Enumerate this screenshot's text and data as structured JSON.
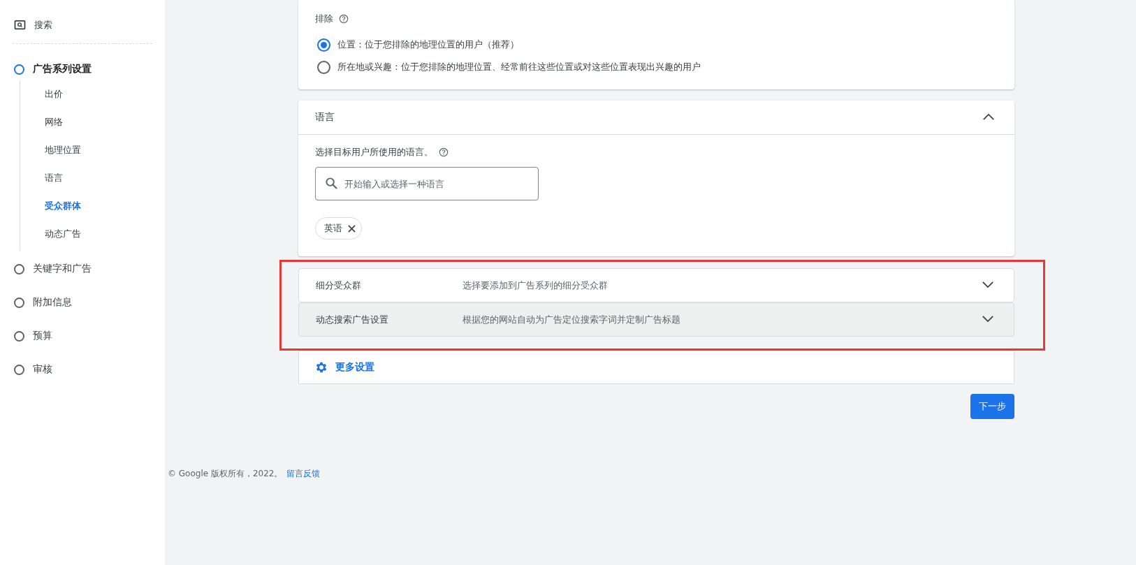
{
  "sidebar": {
    "header": {
      "label": "搜索"
    },
    "steps": [
      {
        "label": "广告系列设置",
        "selected": true,
        "children": [
          {
            "label": "出价",
            "selected": false
          },
          {
            "label": "网络",
            "selected": false
          },
          {
            "label": "地理位置",
            "selected": false
          },
          {
            "label": "语言",
            "selected": false
          },
          {
            "label": "受众群体",
            "selected": true
          },
          {
            "label": "动态广告",
            "selected": false
          }
        ]
      },
      {
        "label": "关键字和广告",
        "selected": false
      },
      {
        "label": "附加信息",
        "selected": false
      },
      {
        "label": "预算",
        "selected": false
      },
      {
        "label": "审核",
        "selected": false
      }
    ]
  },
  "exclusion_card": {
    "label": "排除",
    "options": [
      {
        "label": "位置：位于您排除的地理位置的用户（推荐）",
        "selected": true
      },
      {
        "label": "所在地或兴趣：位于您排除的地理位置、经常前往这些位置或对这些位置表现出兴趣的用户",
        "selected": false
      }
    ]
  },
  "language_card": {
    "title": "语言",
    "expanded": true,
    "prompt": "选择目标用户所使用的语言。",
    "search": {
      "placeholder": "开始输入或选择一种语言"
    },
    "chips": [
      {
        "label": "英语"
      }
    ]
  },
  "panels": [
    {
      "title": "细分受众群",
      "description": "选择要添加到广告系列的细分受众群",
      "expanded": false,
      "hovered": false
    },
    {
      "title": "动态搜索广告设置",
      "description": "根据您的网站自动为广告定位搜索字词并定制广告标题",
      "expanded": false,
      "hovered": true
    }
  ],
  "more_settings": {
    "label": "更多设置"
  },
  "next_button": {
    "label": "下一步"
  },
  "footer": {
    "copyright": "© Google 版权所有，2022。",
    "link": "留言反馈"
  }
}
